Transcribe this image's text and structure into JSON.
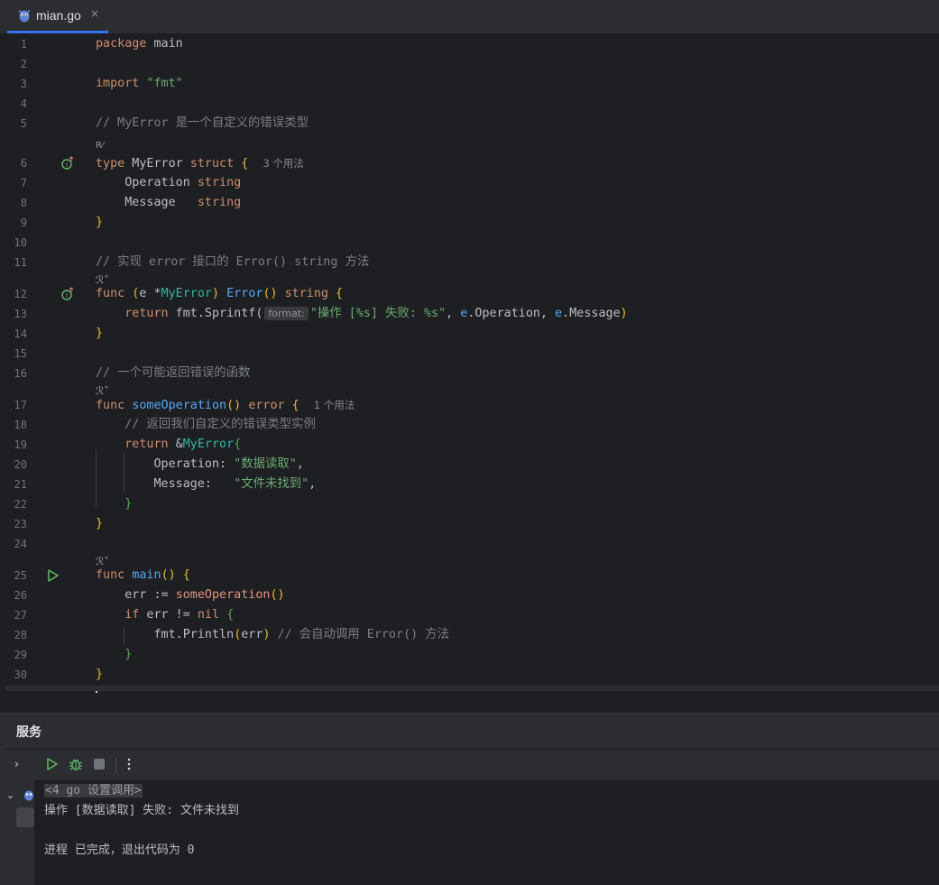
{
  "tab": {
    "name": "mian.go",
    "close": "×"
  },
  "editor": {
    "line_numbers": [
      "1",
      "2",
      "3",
      "4",
      "5",
      "6",
      "7",
      "8",
      "9",
      "10",
      "11",
      "12",
      "13",
      "14",
      "15",
      "16",
      "17",
      "18",
      "19",
      "20",
      "21",
      "22",
      "23",
      "24",
      "25",
      "26",
      "27",
      "28",
      "29",
      "30"
    ],
    "lines": {
      "l1": {
        "kw": "package",
        "rest": " main"
      },
      "l3": {
        "kw": "import",
        "str": "\"fmt\""
      },
      "l5": {
        "comment": "// MyError 是一个自定义的错误类型"
      },
      "hint_impl": "实现接口",
      "l6": {
        "kw1": "type",
        "name": " MyError ",
        "kw2": "struct",
        "brace": " {",
        "usage": "3 个用法"
      },
      "l7": {
        "field": "    Operation ",
        "type": "string"
      },
      "l8": {
        "field": "    Message   ",
        "type": "string"
      },
      "l9": {
        "brace": "}"
      },
      "l11": {
        "comment": "// 实现 error 接口的 Error() string 方法"
      },
      "l12": {
        "kw": "func",
        "p1": " (",
        "recv": "e",
        "star": " *",
        "rtype": "MyError",
        "p2": ") ",
        "fname": "Error",
        "p3": "()",
        "sp": " ",
        "ret": "string",
        "brace": " {"
      },
      "l13": {
        "indent": "    ",
        "kw": "return",
        "call": " fmt.Sprintf(",
        "param_hint": "format:",
        "str": "\"操作 [%s] 失败: %s\"",
        "c1": ", ",
        "e1": "e",
        "f1": ".Operation, ",
        "e2": "e",
        "f2": ".Message",
        "close": ")"
      },
      "l14": {
        "brace": "}"
      },
      "l16": {
        "comment": "// 一个可能返回错误的函数"
      },
      "l17": {
        "kw": "func",
        "sp": " ",
        "fname": "someOperation",
        "p": "()",
        "sp2": " ",
        "ret": "error",
        "brace": " {",
        "usage": "1 个用法"
      },
      "l18": {
        "indent": "    ",
        "comment": "// 返回我们自定义的错误类型实例"
      },
      "l19": {
        "indent": "    ",
        "kw": "return",
        "amp": " &",
        "type": "MyError",
        "brace": "{"
      },
      "l20": {
        "indent": "        ",
        "field": "Operation: ",
        "str": "\"数据读取\"",
        "comma": ","
      },
      "l21": {
        "indent": "        ",
        "field": "Message:   ",
        "str": "\"文件未找到\"",
        "comma": ","
      },
      "l22": {
        "indent": "    ",
        "brace": "}"
      },
      "l23": {
        "brace": "}"
      },
      "l25": {
        "kw": "func",
        "sp": " ",
        "fname": "main",
        "p": "()",
        "brace": " {"
      },
      "l26": {
        "indent": "    ",
        "var": "err := ",
        "fname": "someOperation",
        "p": "()"
      },
      "l27": {
        "indent": "    ",
        "kw": "if",
        "cond": " err != ",
        "nil": "nil",
        "brace": " {"
      },
      "l28": {
        "indent": "        ",
        "call": "fmt.Println",
        "p1": "(",
        "arg": "err",
        "p2": ")",
        "comment": " // 会自动调用 Error() 方法"
      },
      "l29": {
        "indent": "    ",
        "brace": "}"
      },
      "l30": {
        "brace": "}"
      }
    }
  },
  "services": {
    "title": "服务",
    "console": {
      "command": "<4 go 设置调用>",
      "output": "操作 [数据读取] 失败: 文件未找到",
      "exit": "进程 已完成，退出代码为 0"
    }
  },
  "colors": {
    "accent": "#3574f0",
    "keyword": "#cf8e6d",
    "string": "#6aab73",
    "function": "#56a8f5",
    "run": "#5fb865"
  }
}
